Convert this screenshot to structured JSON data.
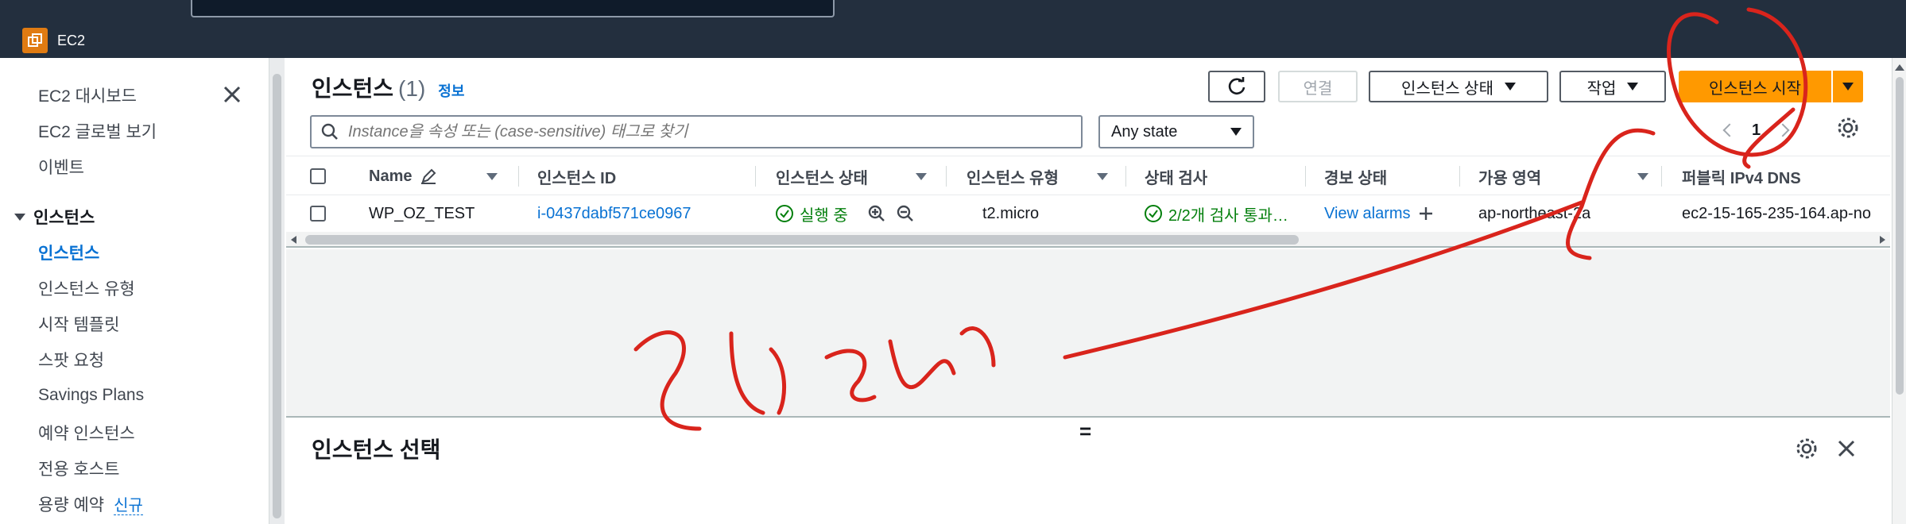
{
  "service": {
    "name": "EC2"
  },
  "sidebar": {
    "items": [
      {
        "label": "EC2 대시보드"
      },
      {
        "label": "EC2 글로벌 보기"
      },
      {
        "label": "이벤트"
      }
    ],
    "section": {
      "label": "인스턴스"
    },
    "sub_items": [
      {
        "label": "인스턴스",
        "active": true
      },
      {
        "label": "인스턴스 유형"
      },
      {
        "label": "시작 템플릿"
      },
      {
        "label": "스팟 요청"
      },
      {
        "label": "Savings Plans"
      },
      {
        "label": "예약 인스턴스"
      },
      {
        "label": "전용 호스트"
      },
      {
        "label": "용량 예약",
        "badge": "신규"
      }
    ]
  },
  "header": {
    "title": "인스턴스",
    "count": "(1)",
    "info_link": "정보"
  },
  "toolbar": {
    "connect_label": "연결",
    "state_label": "인스턴스 상태",
    "actions_label": "작업",
    "launch_label": "인스턴스 시작"
  },
  "filter": {
    "search_placeholder": "Instance을 속성 또는 (case-sensitive) 태그로 찾기",
    "state_select": "Any state"
  },
  "pagination": {
    "page": "1"
  },
  "table": {
    "columns": [
      "Name",
      "인스턴스 ID",
      "인스턴스 상태",
      "인스턴스 유형",
      "상태 검사",
      "경보 상태",
      "가용 영역",
      "퍼블릭 IPv4 DNS"
    ],
    "rows": [
      {
        "name": "WP_OZ_TEST",
        "instance_id": "i-0437dabf571ce0967",
        "state": "실행 중",
        "type": "t2.micro",
        "status_check": "2/2개 검사 통과…",
        "alarm": "View alarms",
        "az": "ap-northeast-2a",
        "dns": "ec2-15-165-235-164.ap-no"
      }
    ]
  },
  "bottom_panel": {
    "title": "인스턴스 선택"
  },
  "colors": {
    "accent": "#ff9900",
    "link": "#0972d3",
    "success": "#037f0c",
    "topbar": "#232f3e",
    "annotation": "#d9241c"
  }
}
